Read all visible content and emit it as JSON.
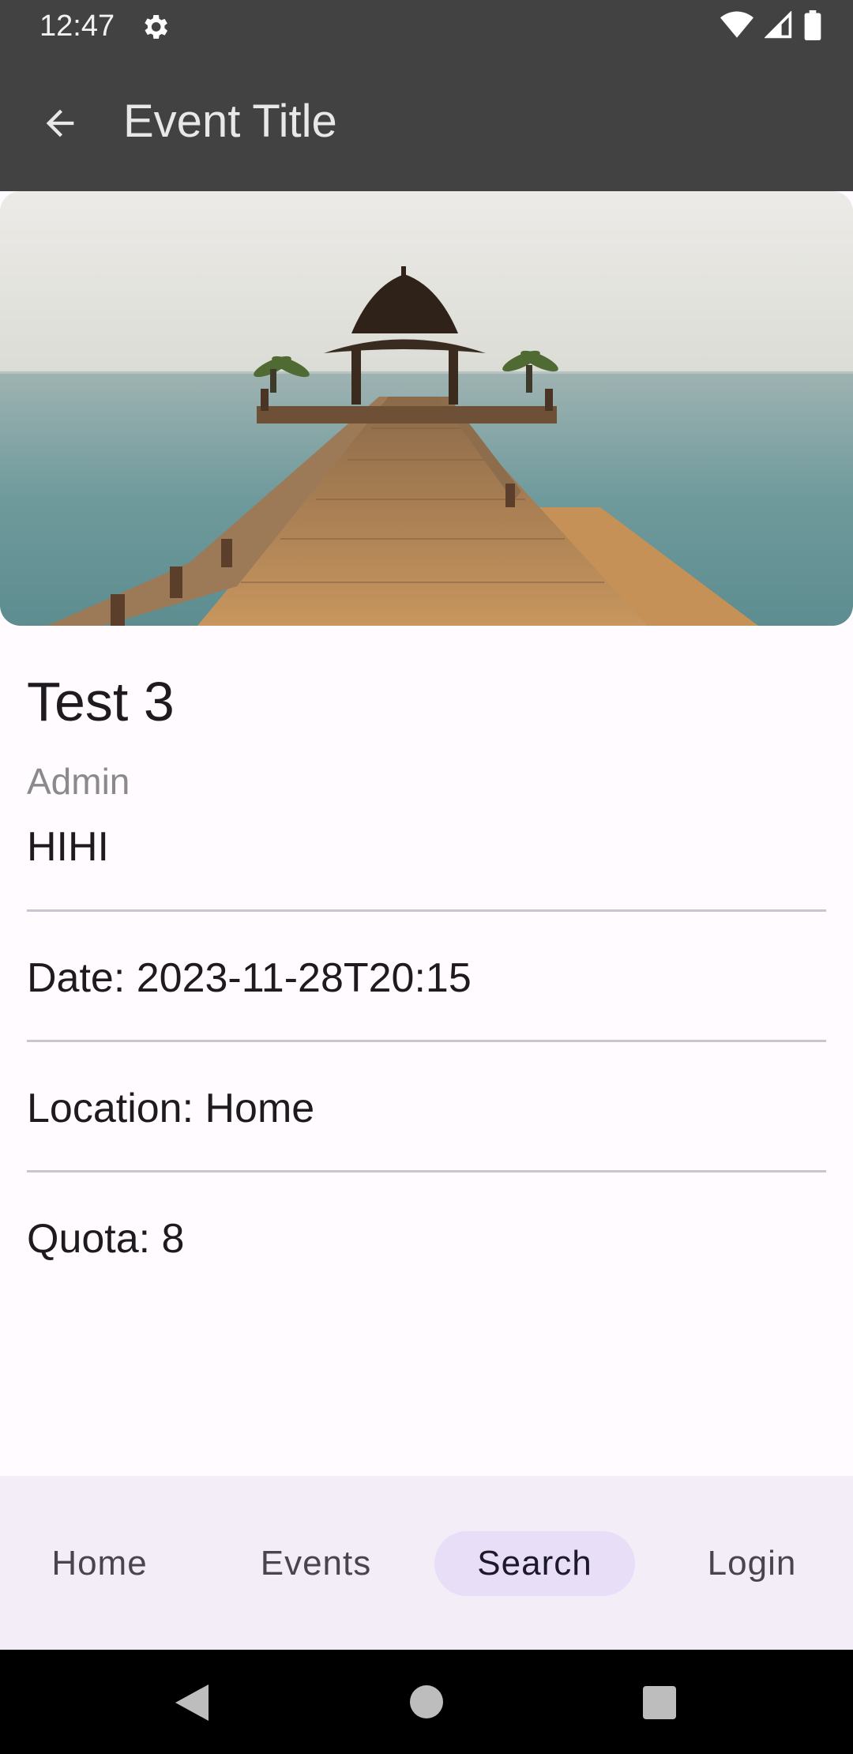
{
  "status_bar": {
    "time": "12:47",
    "icons": [
      "gear-icon",
      "wifi-icon",
      "cellular-icon",
      "battery-icon"
    ]
  },
  "app_bar": {
    "title": "Event Title",
    "back_icon": "arrow-left-icon"
  },
  "event": {
    "image_description_icon": "event-photo",
    "name": "Test 3",
    "owner": "Admin",
    "description": "HIHI",
    "date": "Date: 2023-11-28T20:15",
    "location": "Location: Home",
    "quota": "Quota: 8"
  },
  "bottom_nav": {
    "items": [
      {
        "label": "Home"
      },
      {
        "label": "Events"
      },
      {
        "label": "Search"
      },
      {
        "label": "Login"
      }
    ],
    "active": "Search"
  },
  "system_nav": {
    "icons": [
      "back-triangle-icon",
      "home-circle-icon",
      "recents-square-icon"
    ]
  },
  "colors": {
    "app_bar": "#424242",
    "background": "#fffbfe",
    "nav_background": "#f3edf7",
    "active_pill": "#e8def8"
  }
}
